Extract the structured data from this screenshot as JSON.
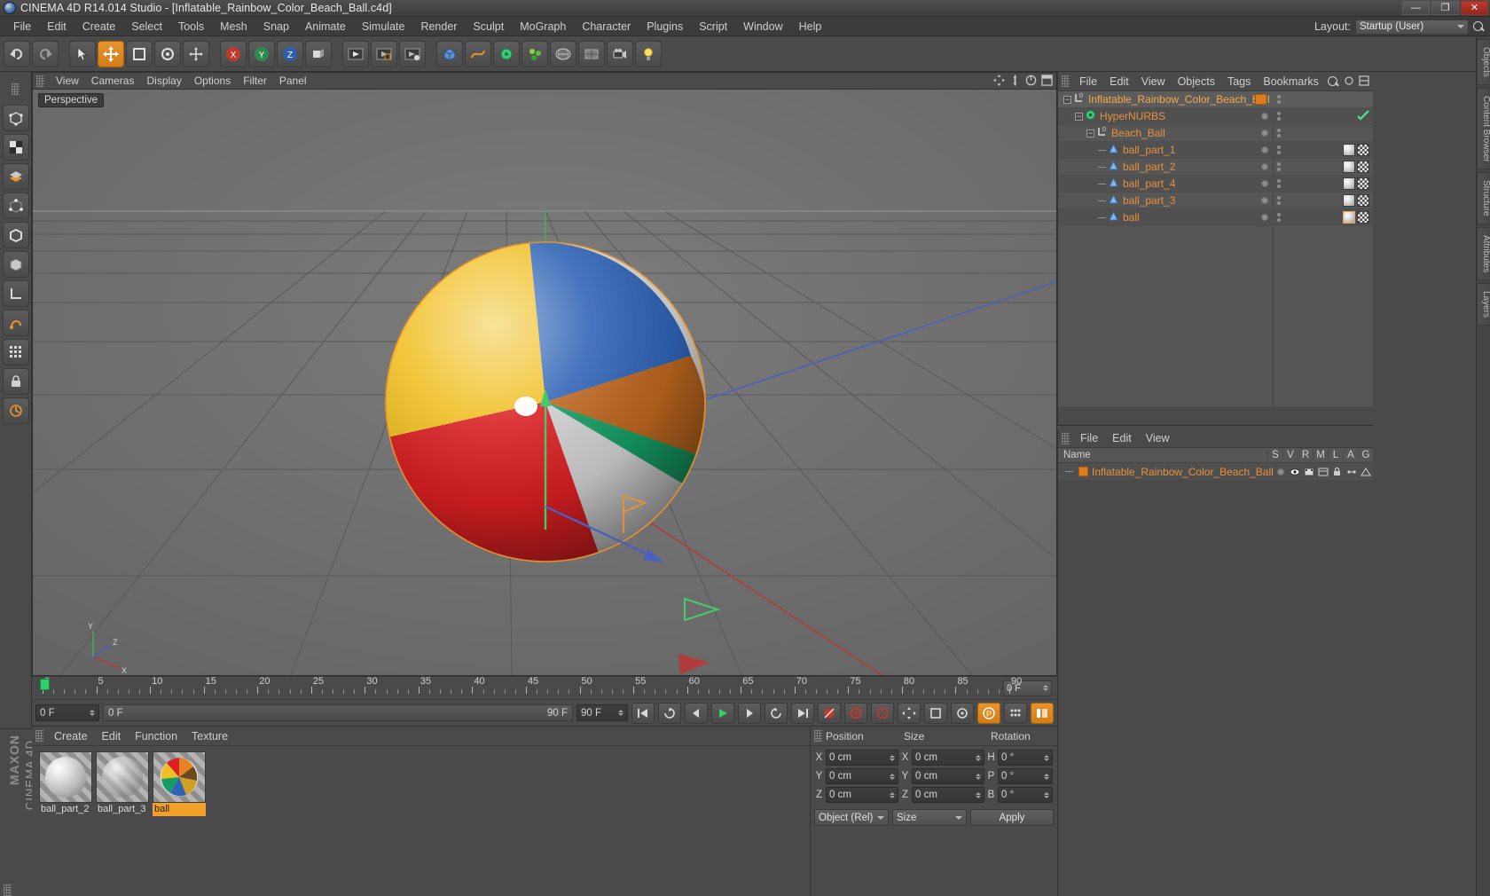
{
  "window": {
    "title": "CINEMA 4D R14.014 Studio - [Inflatable_Rainbow_Color_Beach_Ball.c4d]",
    "minimize": "—",
    "maximize": "❐",
    "close": "✕"
  },
  "menubar": {
    "items": [
      "File",
      "Edit",
      "Create",
      "Select",
      "Tools",
      "Mesh",
      "Snap",
      "Animate",
      "Simulate",
      "Render",
      "Sculpt",
      "MoGraph",
      "Character",
      "Plugins",
      "Script",
      "Window",
      "Help"
    ],
    "layout_label": "Layout:",
    "layout_value": "Startup (User)"
  },
  "viewport": {
    "menus": [
      "View",
      "Cameras",
      "Display",
      "Options",
      "Filter",
      "Panel"
    ],
    "label": "Perspective",
    "axis": {
      "x": "X",
      "y": "Y",
      "z": "Z"
    }
  },
  "timeline": {
    "ticks": [
      "0",
      "5",
      "10",
      "15",
      "20",
      "25",
      "30",
      "35",
      "40",
      "45",
      "50",
      "55",
      "60",
      "65",
      "70",
      "75",
      "80",
      "85",
      "90"
    ],
    "current_frame": "0 F",
    "field_right": "0 F"
  },
  "transport": {
    "frame_current": "0 F",
    "range_start": "0 F",
    "range_end": "90 F",
    "frame_end": "90 F"
  },
  "materials": {
    "menus": [
      "Create",
      "Edit",
      "Function",
      "Texture"
    ],
    "items": [
      {
        "name": "ball_part_2",
        "selected": false,
        "kind": "sphere-white"
      },
      {
        "name": "ball_part_3",
        "selected": false,
        "kind": "sphere-glass"
      },
      {
        "name": "ball",
        "selected": true,
        "kind": "beachball"
      }
    ]
  },
  "coordinates": {
    "headers": [
      "Position",
      "Size",
      "Rotation"
    ],
    "rows": [
      {
        "pos_axis": "X",
        "pos_value": "0 cm",
        "size_axis": "X",
        "size_value": "0 cm",
        "rot_axis": "H",
        "rot_value": "0 °"
      },
      {
        "pos_axis": "Y",
        "pos_value": "0 cm",
        "size_axis": "Y",
        "size_value": "0 cm",
        "rot_axis": "P",
        "rot_value": "0 °"
      },
      {
        "pos_axis": "Z",
        "pos_value": "0 cm",
        "size_axis": "Z",
        "size_value": "0 cm",
        "rot_axis": "B",
        "rot_value": "0 °"
      }
    ],
    "mode_select": "Object (Rel)",
    "size_select": "Size",
    "apply_label": "Apply"
  },
  "object_manager": {
    "menus": [
      "File",
      "Edit",
      "View",
      "Objects",
      "Tags",
      "Bookmarks"
    ],
    "rows": [
      {
        "name": "Inflatable_Rainbow_Color_Beach_Ball",
        "depth": 0,
        "icon": "null-object-icon",
        "selected": true,
        "has_expander": true,
        "color_chip": true,
        "tags": []
      },
      {
        "name": "HyperNURBS",
        "depth": 1,
        "icon": "hypernurbs-icon",
        "selected": false,
        "has_expander": true,
        "color_chip": false,
        "tags": [
          "check"
        ]
      },
      {
        "name": "Beach_Ball",
        "depth": 2,
        "icon": "null-object-icon",
        "selected": false,
        "has_expander": true,
        "color_chip": false,
        "tags": []
      },
      {
        "name": "ball_part_1",
        "depth": 3,
        "icon": "polygon-object-icon",
        "selected": false,
        "has_expander": false,
        "color_chip": false,
        "tags": [
          "mat",
          "tex"
        ]
      },
      {
        "name": "ball_part_2",
        "depth": 3,
        "icon": "polygon-object-icon",
        "selected": false,
        "has_expander": false,
        "color_chip": false,
        "tags": [
          "mat",
          "tex"
        ]
      },
      {
        "name": "ball_part_4",
        "depth": 3,
        "icon": "polygon-object-icon",
        "selected": false,
        "has_expander": false,
        "color_chip": false,
        "tags": [
          "mat",
          "tex"
        ]
      },
      {
        "name": "ball_part_3",
        "depth": 3,
        "icon": "polygon-object-icon",
        "selected": false,
        "has_expander": false,
        "color_chip": false,
        "tags": [
          "mat",
          "tex"
        ]
      },
      {
        "name": "ball",
        "depth": 3,
        "icon": "polygon-object-icon",
        "selected": false,
        "has_expander": false,
        "color_chip": false,
        "tags": [
          "mat-sel",
          "tex"
        ]
      }
    ]
  },
  "layer_manager": {
    "menus": [
      "File",
      "Edit",
      "View"
    ],
    "columns": [
      "Name",
      "S",
      "V",
      "R",
      "M",
      "L",
      "A",
      "G"
    ],
    "rows": [
      {
        "name": "Inflatable_Rainbow_Color_Beach_Ball",
        "color": "#e07c1e"
      }
    ]
  },
  "right_dock": {
    "tabs": [
      "Objects",
      "Content Browser",
      "Structure",
      "Attributes",
      "Layers"
    ]
  },
  "brand": {
    "maxon": "MAXON",
    "product": "CINEMA 4D"
  },
  "colors": {
    "accent": "#e8932c",
    "object_text": "#e8913a",
    "green": "#2fcf6b",
    "chip": "#e07c1e"
  }
}
